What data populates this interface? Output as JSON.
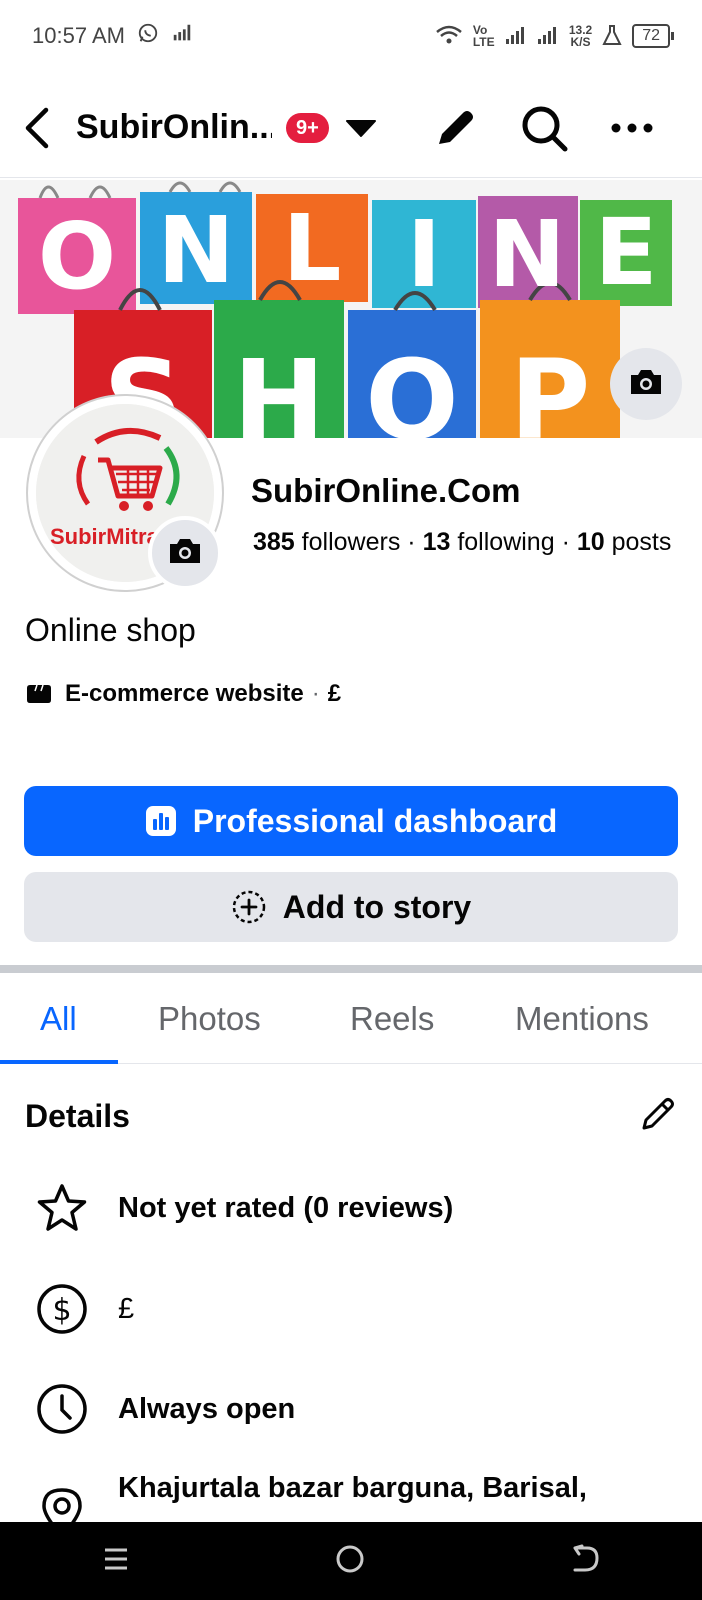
{
  "status_bar": {
    "time": "10:57 AM",
    "network_label": "Vo LTE",
    "speed_value": "13.2",
    "speed_unit": "K/S",
    "battery": "72",
    "icons": [
      "whatsapp-icon",
      "signal-boost-icon",
      "wifi-icon",
      "cell-signal-icon",
      "cell-signal-icon",
      "lab-icon",
      "battery-icon"
    ]
  },
  "top_bar": {
    "page_name": "SubirOnlin...",
    "notification_count": "9+",
    "icons": [
      "back-arrow-icon",
      "caret-down-icon",
      "pencil-icon",
      "search-icon",
      "more-icon"
    ]
  },
  "cover": {
    "image_text_top": "ONLINE",
    "image_text_bottom": "SHOP"
  },
  "avatar": {
    "logo_text": "SubirMitra"
  },
  "profile": {
    "name": "SubirOnline.Com",
    "followers_count": "385",
    "followers_label": "followers",
    "following_count": "13",
    "following_label": "following",
    "posts_count": "10",
    "posts_label": "posts",
    "separator": "·",
    "bio": "Online shop",
    "category": "E-commerce website",
    "price_range": "£"
  },
  "buttons": {
    "dashboard_label": "Professional dashboard",
    "story_label": "Add to story"
  },
  "tabs": [
    {
      "label": "All",
      "active": true
    },
    {
      "label": "Photos",
      "active": false
    },
    {
      "label": "Reels",
      "active": false
    },
    {
      "label": "Mentions",
      "active": false
    }
  ],
  "details": {
    "title": "Details",
    "rating": "Not yet rated (0 reviews)",
    "price": "£",
    "hours": "Always open",
    "address": "Khajurtala bazar barguna, Barisal,"
  },
  "colors": {
    "brand_blue": "#0866ff",
    "badge_red": "#e41e3f",
    "secondary_gray": "#e4e6eb"
  }
}
